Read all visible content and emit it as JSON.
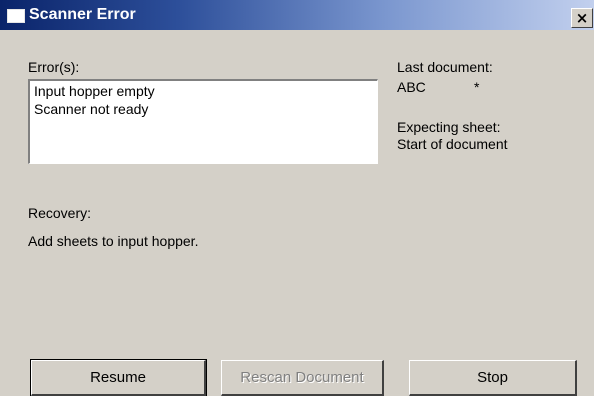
{
  "window": {
    "title": "Scanner Error",
    "close_glyph": "×"
  },
  "errors": {
    "label": "Error(s):",
    "items": [
      "Input hopper empty",
      "Scanner not ready"
    ]
  },
  "last_document": {
    "label": "Last document:",
    "value": "ABC",
    "marker": "*"
  },
  "expecting_sheet": {
    "label": "Expecting sheet:",
    "value": "Start of document"
  },
  "recovery": {
    "label": "Recovery:",
    "message": "Add sheets to input hopper."
  },
  "buttons": {
    "resume": "Resume",
    "rescan": "Rescan Document",
    "stop": "Stop"
  },
  "icons": {
    "window_icon": "window-icon",
    "close_icon": "close-icon"
  }
}
